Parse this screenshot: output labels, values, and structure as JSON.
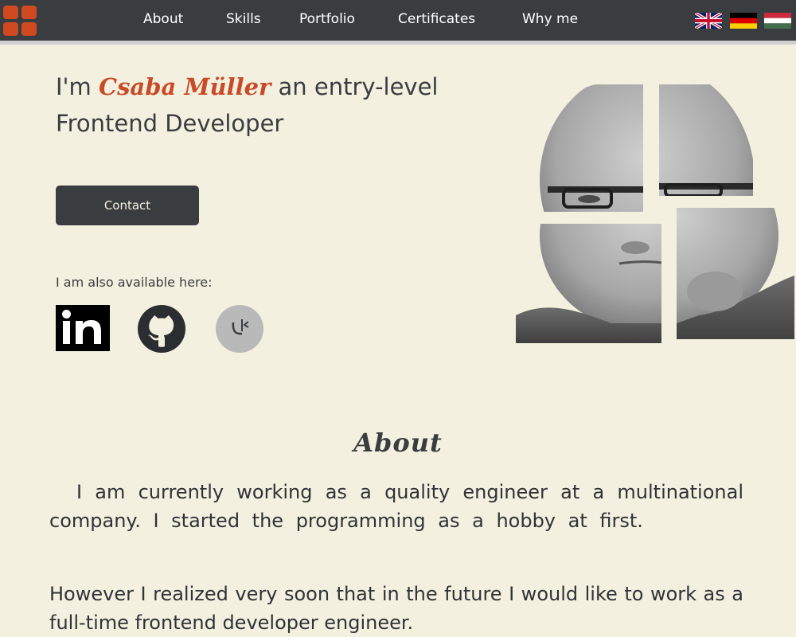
{
  "nav": {
    "items": [
      "About",
      "Skills",
      "Portfolio",
      "Certificates",
      "Why me"
    ],
    "flags": [
      "flag-uk-icon",
      "flag-germany-icon",
      "flag-hungary-icon"
    ],
    "logo_icon": "grid-logo-icon"
  },
  "hero": {
    "prefix": "I'm",
    "name": "Csaba Müller",
    "suffix_line1": "an entry-level",
    "line2": "Frontend Developer",
    "contact_label": "Contact",
    "available_text": "I am also available here:",
    "socials": [
      "linkedin-icon",
      "github-icon",
      "kaggle-icon"
    ]
  },
  "about": {
    "title": "About",
    "p1": "I am currently working as a quality engineer at a multinational company. I started the programming as a hobby at first.",
    "p2": "However I realized very soon that in the future I would like to work as a full-time frontend developer engineer."
  },
  "colors": {
    "background": "#f4f0df",
    "navbar": "#3a3d40",
    "accent": "#c94a26",
    "button": "#3a3d40"
  }
}
